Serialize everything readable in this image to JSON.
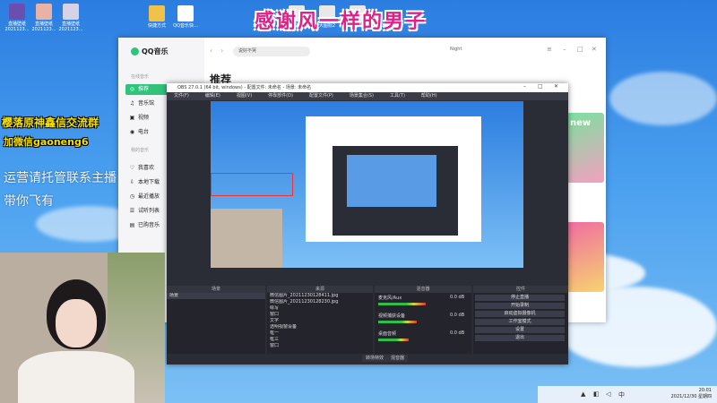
{
  "banner": {
    "title": "感谢风一样的男子"
  },
  "desktop_icons": [
    {
      "label": "直播壁纸 2021123..."
    },
    {
      "label": "直播壁纸 2021123..."
    },
    {
      "label": "直播壁纸 2021123..."
    },
    {
      "label": "快捷方式"
    },
    {
      "label": "QQ音乐快..."
    },
    {
      "label": "大图标1"
    },
    {
      "label": "大图标2"
    },
    {
      "label": "大图标3"
    }
  ],
  "qq": {
    "logo": "QQ音乐",
    "section_online": "在线音乐",
    "section_mine": "我的音乐",
    "nav": [
      {
        "label": "推荐",
        "icon": "◎",
        "active": true
      },
      {
        "label": "音乐馆",
        "icon": "♫"
      },
      {
        "label": "视频",
        "icon": "▣"
      },
      {
        "label": "电台",
        "icon": "◉"
      }
    ],
    "nav_mine": [
      {
        "label": "我喜欢",
        "icon": "♡"
      },
      {
        "label": "本地下载",
        "icon": "⇩"
      },
      {
        "label": "最近播放",
        "icon": "◷"
      },
      {
        "label": "试听列表",
        "icon": "☰"
      },
      {
        "label": "已购音乐",
        "icon": "▤"
      }
    ],
    "search_placeholder": "说好不哭",
    "heading": "推荐",
    "user": "Night",
    "thumb_label": "new"
  },
  "obs": {
    "title": "OBS 27.0.1 (64 bit, windows) - 配置文件: 未命名 - 场景: 未命名",
    "menu": [
      "文件(F)",
      "编辑(E)",
      "视图(V)",
      "停靠部件(D)",
      "配置文件(P)",
      "场景集合(S)",
      "工具(T)",
      "帮助(H)"
    ],
    "docks": {
      "scenes_title": "场景",
      "sources_title": "来源",
      "mixer_title": "混音器",
      "controls_title": "控件"
    },
    "scenes": [
      "场景"
    ],
    "sources": [
      "微信图片_20211230128411.jpg",
      "微信图片_20211230128230.jpg",
      "绘写",
      "窗口",
      "文字",
      "透明视窗设备",
      "框一",
      "框三",
      "窗口",
      "跑马"
    ],
    "mixer": [
      {
        "name": "麦克风/Aux",
        "db": "0.0 dB",
        "level": 0.55
      },
      {
        "name": "视频捕获设备",
        "db": "0.0 dB",
        "level": 0.45
      },
      {
        "name": "桌面音频",
        "db": "0.0 dB",
        "level": 0.35
      }
    ],
    "controls": [
      "停止直播",
      "开始录制",
      "启动虚拟摄像机",
      "工作室模式",
      "设置",
      "退出"
    ],
    "bottom_tabs": [
      "转场特效",
      "混音器"
    ]
  },
  "overlay": {
    "line1": "樱落原神鑫信交流群",
    "line2": "加微信gaoneng6",
    "line3": "运营请托管联系主播",
    "line4": "带你飞有"
  },
  "clock": {
    "time": "20:01",
    "date": "2021/12/30 星期四"
  }
}
